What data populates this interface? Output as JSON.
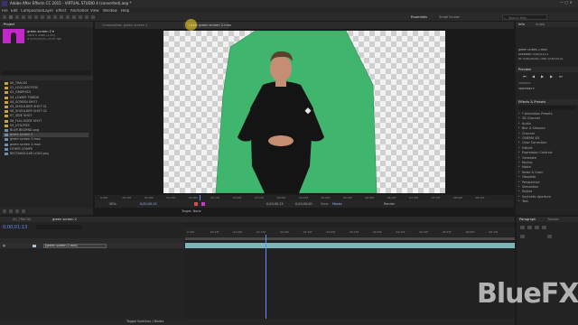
{
  "app": {
    "title": "Adobe After Effects CC 2015 - VIRTUAL STUDIO 4 (converted).aep *"
  },
  "menu": [
    "File",
    "Edit",
    "Composition",
    "Layer",
    "Effect",
    "Animation",
    "View",
    "Window",
    "Help"
  ],
  "toolbar": {
    "workspace_tabs": [
      "Essentials",
      "Small Screen"
    ],
    "search_placeholder": "Search Help"
  },
  "project": {
    "tab": "Project",
    "selected_name": "green screen 2 ▾",
    "selected_info": [
      "1920 x 1080 (1.00)",
      "Δ 0;00;30;00, 29.97 fps"
    ],
    "items": [
      "00_TRACKS",
      "01_LOGO/MOTION",
      "02_GRAPHICS",
      "03_LOWER THIRDS",
      "04_SCREEN SHOT",
      "05_SHOULDER SHOT 01",
      "06_SHOULDER SHOT 02",
      "07_SIDE SHOT",
      "08_FULL BODY SHOT",
      "09_UTILITIES",
      "BLUR BKGRND.png",
      "green screen 2",
      "green screen 2.mov",
      "green screen 2.mov",
      "OTHER COMPS",
      "RECTANGULAR LOGO.png"
    ],
    "selected_index": 11
  },
  "comp_viewer": {
    "tabs": [
      "Composition green screen 2",
      "Layer green screen 2.mov"
    ],
    "ruler": [
      "0:00f",
      "00:15f",
      "01:00f",
      "01:15f",
      "02:00f",
      "02:15f",
      "03:00f",
      "03:15f",
      "04:00f",
      "04:15f",
      "05:00f",
      "05:15f",
      "06:00f",
      "06:15f",
      "07:00f",
      "07:15f",
      "08:00f",
      "08:15f"
    ],
    "zoom": "50%",
    "timecode_in": "0;00;00;13",
    "timecode_out": "0;00;00;13",
    "duration": "0;00;00;00",
    "view_label": "View:",
    "view_value": "Masks",
    "render": "Render",
    "target": "Target: None"
  },
  "right_panel": {
    "info_tab": "Info",
    "audio_tab": "Audio",
    "info_lines": [
      "green screen 2.mov",
      "Duration: 0;00;03;21",
      "In: 0;00;00;00, Out: 0;00;03;21"
    ],
    "preview_tab": "Preview",
    "preview_label": "Shortcut",
    "preview_value": "Spacebar ▾",
    "effects_tab": "Effects & Presets",
    "effects": [
      "* Animation Presets",
      "3D Channel",
      "Audio",
      "Blur & Sharpen",
      "Channel",
      "CINEMA 4D",
      "Color Correction",
      "Distort",
      "Expression Controls",
      "Generate",
      "Keying",
      "Matte",
      "Noise & Grain",
      "Obsolete",
      "Perspective",
      "Simulation",
      "Stylize",
      "Synthetic Aperture",
      "Text"
    ],
    "paragraph_tab": "Paragraph",
    "tracker_tab": "Tracker"
  },
  "timeline": {
    "tabs": [
      "00_TRACKS",
      "green screen 2"
    ],
    "timecode": "0;00;01;13",
    "layer_name": "[green screen 2.mov]",
    "ruler": [
      "0:00f",
      "00:15f",
      "01:00f",
      "01:15f",
      "02:00f",
      "02:15f",
      "03:00f",
      "03:15f",
      "04:00f",
      "04:15f",
      "05:00f",
      "05:15f",
      "06:00f",
      "06:15f"
    ],
    "footer": "Toggle Switches / Modes"
  },
  "watermark": "BlueFX"
}
